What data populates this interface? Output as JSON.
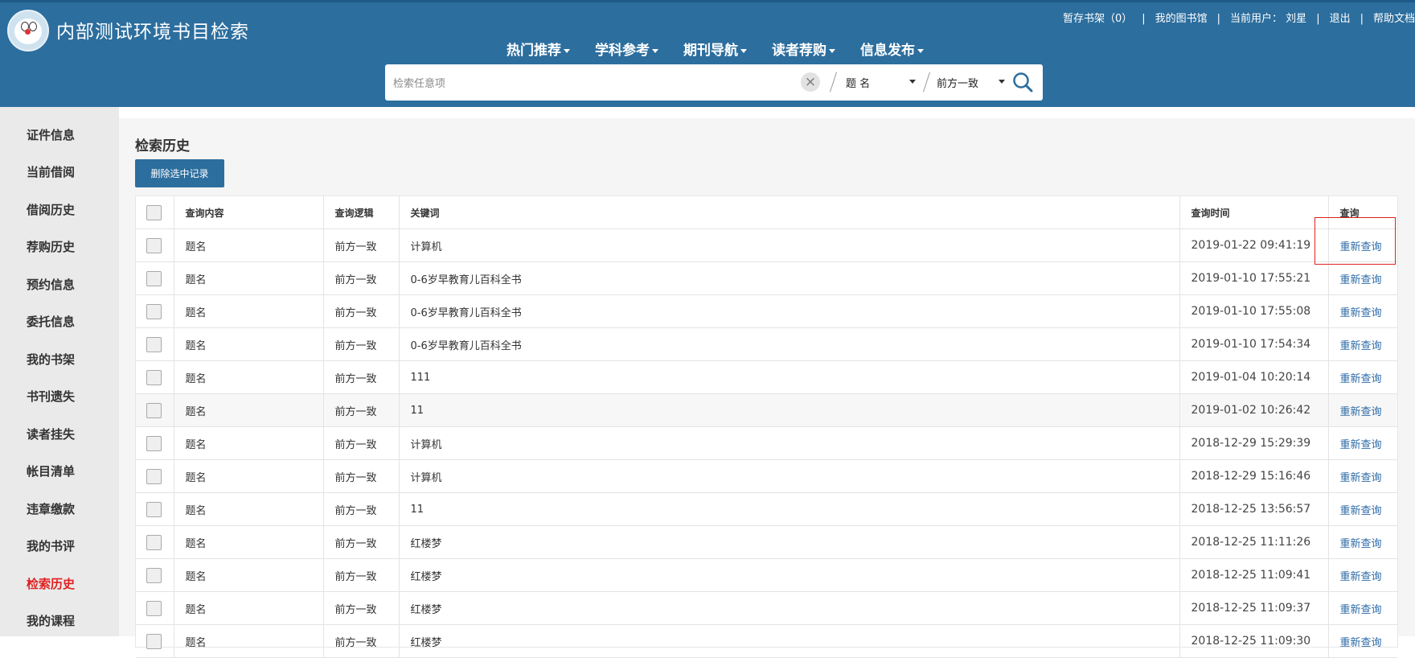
{
  "header": {
    "title": "内部测试环境书目检索",
    "top_links": {
      "temp_shelf": "暂存书架（0）",
      "my_library": "我的图书馆",
      "current_user_label": "当前用户：",
      "current_user": "刘星",
      "logout": "退出",
      "help": "帮助文档"
    },
    "nav": [
      "热门推荐",
      "学科参考",
      "期刊导航",
      "读者荐购",
      "信息发布"
    ],
    "search": {
      "placeholder": "检索任意项",
      "field_select": "题 名",
      "match_select": "前方一致"
    }
  },
  "sidebar": {
    "items": [
      "证件信息",
      "当前借阅",
      "借阅历史",
      "荐购历史",
      "预约信息",
      "委托信息",
      "我的书架",
      "书刊遗失",
      "读者挂失",
      "帐目清单",
      "违章缴款",
      "我的书评",
      "检索历史",
      "我的课程"
    ],
    "active_index": 12
  },
  "main": {
    "title": "检索历史",
    "delete_button": "删除选中记录",
    "columns": [
      "查询内容",
      "查询逻辑",
      "关键词",
      "查询时间",
      "查询"
    ],
    "rows": [
      {
        "content": "题名",
        "logic": "前方一致",
        "keyword": "计算机",
        "time": "2019-01-22 09:41:19",
        "action": "重新查询"
      },
      {
        "content": "题名",
        "logic": "前方一致",
        "keyword": "0-6岁早教育儿百科全书",
        "time": "2019-01-10 17:55:21",
        "action": "重新查询"
      },
      {
        "content": "题名",
        "logic": "前方一致",
        "keyword": "0-6岁早教育儿百科全书",
        "time": "2019-01-10 17:55:08",
        "action": "重新查询"
      },
      {
        "content": "题名",
        "logic": "前方一致",
        "keyword": "0-6岁早教育儿百科全书",
        "time": "2019-01-10 17:54:34",
        "action": "重新查询"
      },
      {
        "content": "题名",
        "logic": "前方一致",
        "keyword": "111",
        "time": "2019-01-04 10:20:14",
        "action": "重新查询"
      },
      {
        "content": "题名",
        "logic": "前方一致",
        "keyword": "11",
        "time": "2019-01-02 10:26:42",
        "action": "重新查询"
      },
      {
        "content": "题名",
        "logic": "前方一致",
        "keyword": "计算机",
        "time": "2018-12-29 15:29:39",
        "action": "重新查询"
      },
      {
        "content": "题名",
        "logic": "前方一致",
        "keyword": "计算机",
        "time": "2018-12-29 15:16:46",
        "action": "重新查询"
      },
      {
        "content": "题名",
        "logic": "前方一致",
        "keyword": "11",
        "time": "2018-12-25 13:56:57",
        "action": "重新查询"
      },
      {
        "content": "题名",
        "logic": "前方一致",
        "keyword": "红楼梦",
        "time": "2018-12-25 11:11:26",
        "action": "重新查询"
      },
      {
        "content": "题名",
        "logic": "前方一致",
        "keyword": "红楼梦",
        "time": "2018-12-25 11:09:41",
        "action": "重新查询"
      },
      {
        "content": "题名",
        "logic": "前方一致",
        "keyword": "红楼梦",
        "time": "2018-12-25 11:09:37",
        "action": "重新查询"
      },
      {
        "content": "题名",
        "logic": "前方一致",
        "keyword": "红楼梦",
        "time": "2018-12-25 11:09:30",
        "action": "重新查询"
      }
    ]
  },
  "colors": {
    "header_bg": "#2c6e9e",
    "active_sidebar": "#e12020",
    "link": "#2b6aa7",
    "highlight_box": "#e02020"
  }
}
